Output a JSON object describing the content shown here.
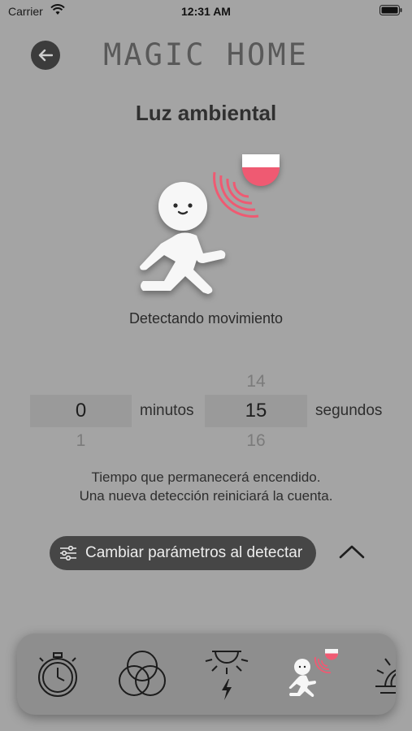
{
  "status_bar": {
    "carrier": "Carrier",
    "time": "12:31 AM"
  },
  "header": {
    "app_title": "MAGIC HOME"
  },
  "page": {
    "title": "Luz ambiental",
    "detect_status": "Detectando movimiento"
  },
  "timer_picker": {
    "minutes": {
      "above": "",
      "selected": "0",
      "below": "1",
      "unit": "minutos"
    },
    "seconds": {
      "above": "14",
      "selected": "15",
      "below": "16",
      "unit": "segundos"
    }
  },
  "explanation": {
    "line1": "Tiempo que permanecerá encendido.",
    "line2": "Una nueva detección reiniciará la cuenta."
  },
  "params_button": {
    "label": "Cambiar parámetros al detectar"
  },
  "tab_bar": {
    "tabs": [
      {
        "name": "timer",
        "icon": "stopwatch-icon"
      },
      {
        "name": "colors",
        "icon": "color-circles-icon"
      },
      {
        "name": "light-power",
        "icon": "ceiling-light-icon"
      },
      {
        "name": "motion",
        "icon": "motion-sensor-icon",
        "selected": true
      },
      {
        "name": "sunrise",
        "icon": "sun-icon"
      }
    ]
  },
  "colors": {
    "accent_red": "#ef5a72",
    "background": "#a4a4a4"
  }
}
